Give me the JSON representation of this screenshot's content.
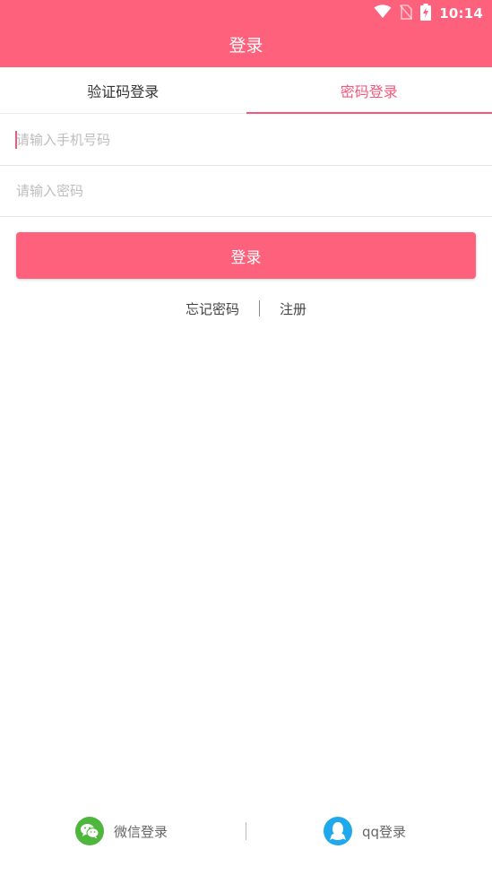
{
  "status_bar": {
    "time": "10:14",
    "icons": [
      "wifi-icon",
      "no-sim-icon",
      "battery-charging-icon"
    ]
  },
  "header": {
    "title": "登录",
    "color": "#fe617c"
  },
  "tabs": [
    {
      "label": "验证码登录",
      "active": false
    },
    {
      "label": "密码登录",
      "active": true
    }
  ],
  "form": {
    "phone_placeholder": "请输入手机号码",
    "phone_value": "",
    "password_placeholder": "请输入密码",
    "password_value": "",
    "login_label": "登录"
  },
  "links": {
    "forgot_password": "忘记密码",
    "register": "注册"
  },
  "social": {
    "wechat_label": "微信登录",
    "wechat_color": "#4eb53d",
    "qq_label": "qq登录",
    "qq_color": "#1fa9ec"
  },
  "accent_color": "#f5587a"
}
